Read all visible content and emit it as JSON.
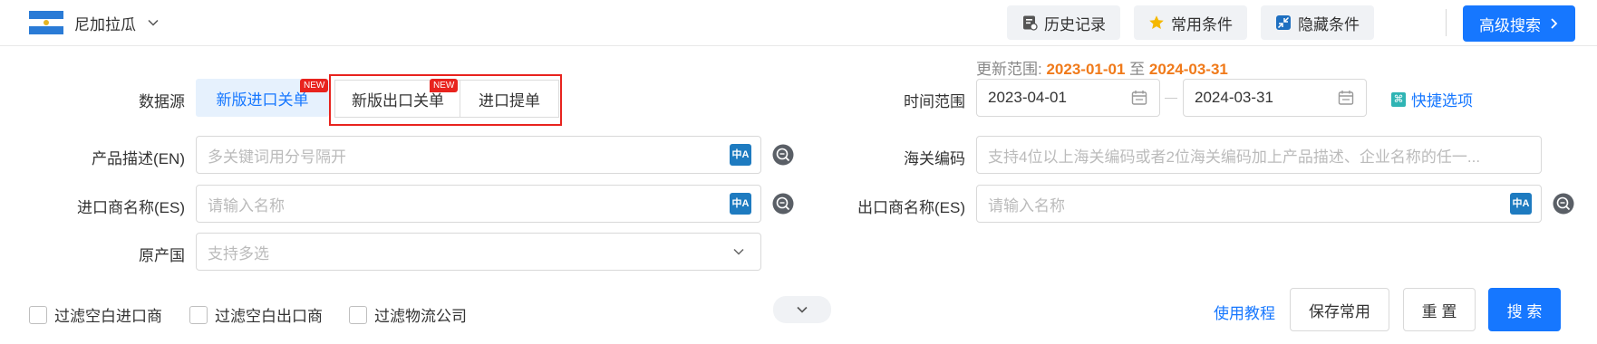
{
  "header": {
    "country": "尼加拉瓜",
    "history_label": "历史记录",
    "favorite_label": "常用条件",
    "hide_label": "隐藏条件",
    "advanced_label": "高级搜索"
  },
  "update_range": {
    "prefix": "更新范围:",
    "start": "2023-01-01",
    "sep": "至",
    "end": "2024-03-31"
  },
  "datasource": {
    "label": "数据源",
    "options": [
      "新版进口关单",
      "新版出口关单",
      "进口提单"
    ],
    "new_badge": "NEW",
    "selected": "新版进口关单"
  },
  "time_range": {
    "label": "时间范围",
    "start": "2023-04-01",
    "end": "2024-03-31",
    "quick_label": "快捷选项"
  },
  "fields": {
    "product_label": "产品描述(EN)",
    "product_placeholder": "多关键词用分号隔开",
    "hs_label": "海关编码",
    "hs_placeholder": "支持4位以上海关编码或者2位海关编码加上产品描述、企业名称的任一...",
    "importer_label": "进口商名称(ES)",
    "importer_placeholder": "请输入名称",
    "exporter_label": "出口商名称(ES)",
    "exporter_placeholder": "请输入名称",
    "origin_label": "原产国",
    "origin_placeholder": "支持多选",
    "translate_glyph": "中A"
  },
  "filters": [
    "过滤空白进口商",
    "过滤空白出口商",
    "过滤物流公司"
  ],
  "actions": {
    "tutorial": "使用教程",
    "save": "保存常用",
    "reset": "重 置",
    "search": "搜 索"
  },
  "colors": {
    "accent": "#1677ff",
    "highlight": "#f07a1a",
    "badge": "#e8231e"
  }
}
